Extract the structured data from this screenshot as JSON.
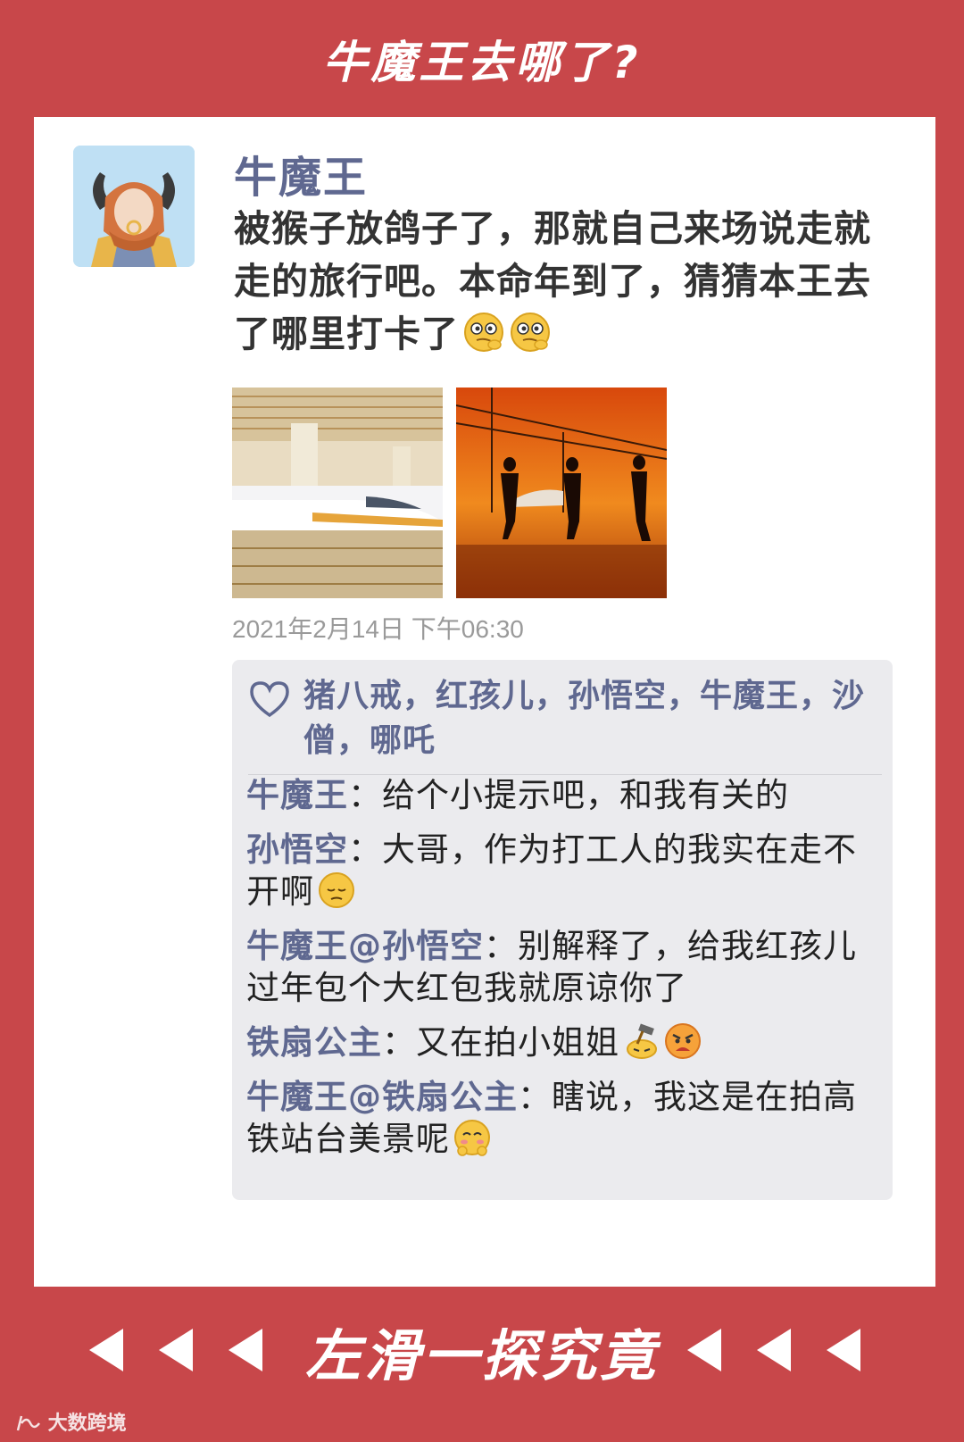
{
  "header": {
    "title": "牛魔王去哪了?"
  },
  "post": {
    "author": "牛魔王",
    "text": "被猴子放鸽子了，那就自己来场说走就走的旅行吧。本命年到了，猜猜本王去了哪里打卡了",
    "timestamp": "2021年2月14日 下午06:30",
    "photos": [
      {
        "name": "high-speed-train-station-photo"
      },
      {
        "name": "sunset-platform-silhouettes-photo"
      }
    ],
    "likes": "猪八戒，红孩儿，孙悟空，牛魔王，沙僧，哪吒"
  },
  "comments": [
    {
      "author": "牛魔王",
      "text": "：给个小提示吧，和我有关的"
    },
    {
      "author": "孙悟空",
      "text": "：大哥，作为打工人的我实在走不开啊"
    },
    {
      "author": "牛魔王@孙悟空",
      "text": "：别解释了，给我红孩儿过年包个大红包我就原谅你了"
    },
    {
      "author": "铁扇公主",
      "text": "：又在拍小姐姐"
    },
    {
      "author": "牛魔王@铁扇公主",
      "text": "：瞎说，我这是在拍高铁站台美景呢"
    }
  ],
  "footer": {
    "cta": "左滑一探究竟"
  },
  "watermark": "大数跨境",
  "colors": {
    "background": "#c8474a",
    "name_blue": "#5f6890",
    "card": "#ffffff",
    "comment_bg": "#ebebee"
  }
}
